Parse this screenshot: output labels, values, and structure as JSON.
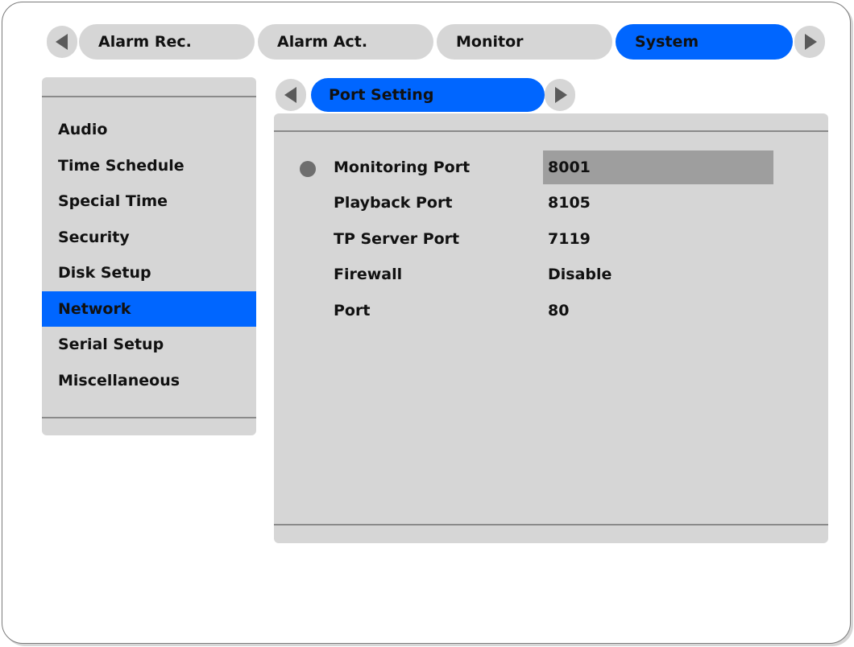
{
  "top_tabs": [
    {
      "label": "Alarm Rec.",
      "active": false
    },
    {
      "label": "Alarm Act.",
      "active": false
    },
    {
      "label": "Monitor",
      "active": false
    },
    {
      "label": "System",
      "active": true
    }
  ],
  "sidebar": {
    "items": [
      {
        "label": "Audio",
        "selected": false
      },
      {
        "label": "Time Schedule",
        "selected": false
      },
      {
        "label": "Special Time",
        "selected": false
      },
      {
        "label": "Security",
        "selected": false
      },
      {
        "label": "Disk Setup",
        "selected": false
      },
      {
        "label": "Network",
        "selected": true
      },
      {
        "label": "Serial Setup",
        "selected": false
      },
      {
        "label": "Miscellaneous",
        "selected": false
      }
    ]
  },
  "subtab": {
    "label": "Port Setting"
  },
  "settings": {
    "rows": [
      {
        "label": "Monitoring Port",
        "value": "8001",
        "focused": true
      },
      {
        "label": "Playback Port",
        "value": "8105",
        "focused": false
      },
      {
        "label": "TP Server Port",
        "value": "7119",
        "focused": false
      },
      {
        "label": "Firewall",
        "value": "Disable",
        "focused": false
      },
      {
        "label": "Port",
        "value": "80",
        "focused": false
      }
    ]
  },
  "colors": {
    "accent": "#0066ff",
    "panel": "#d6d6d6",
    "arrow": "#5a5a5a",
    "focus_value": "#9e9e9e"
  },
  "icons": {
    "prev_tab": "triangle-left-icon",
    "next_tab": "triangle-right-icon",
    "prev_subtab": "triangle-left-icon",
    "next_subtab": "triangle-right-icon",
    "row_focus": "circle-bullet-icon"
  }
}
